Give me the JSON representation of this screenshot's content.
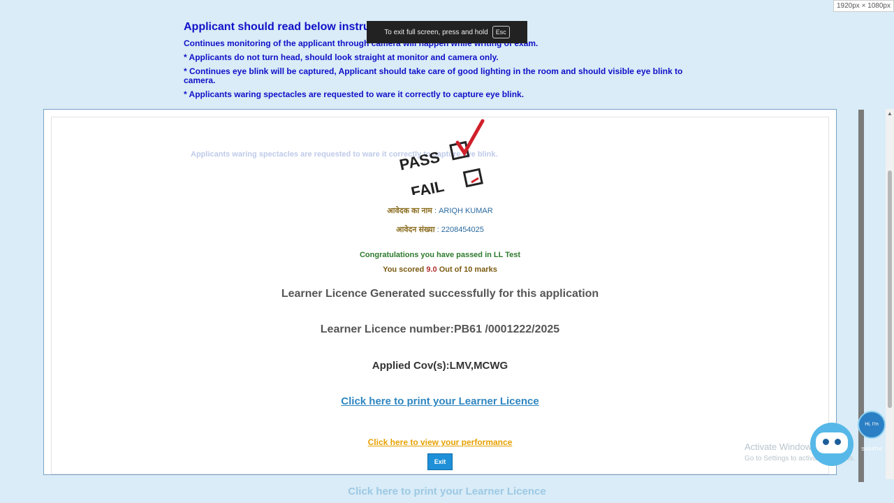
{
  "screen": {
    "resolution_badge": "1920px × 1080px"
  },
  "instructions": {
    "title": "Applicant should read below instru",
    "lines": [
      "Continues monitoring of the applicant through camera will happen while writing of exam.",
      "* Applicants do not turn head, should look straight at monitor and camera only.",
      "* Continues eye blink will be captured, Applicant should take care of good lighting in the room and should visible eye blink to camera.",
      "* Applicants waring spectacles are requested to ware it correctly to capture eye blink."
    ]
  },
  "fullscreen_toast": {
    "text": "To exit full screen, press and hold",
    "key": "Esc"
  },
  "ghost_text": "Applicants waring spectacles are requested to ware it correctly to capture eye blink.",
  "stamp": {
    "pass": "PASS",
    "fail": "FAIL"
  },
  "result": {
    "name_label": "आवेदक का नाम",
    "name_value": ": ARIQH KUMAR",
    "number_label": "आवेदन संख्या",
    "number_value": ": 2208454025",
    "congrats": "Congratulations you have passed in LL Test",
    "score_prefix": "You scored",
    "score_value": "9.0",
    "score_suffix": "Out of 10 marks",
    "ll_generated": "Learner Licence Generated successfully for this application",
    "ll_number": "Learner Licence number:PB61 /0001222/2025",
    "applied_cov": "Applied Cov(s):LMV,MCWG",
    "print_link": "Click here to print your Learner Licence",
    "performance_link": "Click here to view your performance",
    "exit_button": "Exit"
  },
  "windows_watermark": {
    "line1": "Activate Windows",
    "line2": "Go to Settings to activate Windows."
  },
  "chatbot": {
    "label": "Hi, I'm SARATHI"
  },
  "colors": {
    "background": "#d9ecf7",
    "instruction_text": "#1010c8",
    "link_blue": "#2e86c1",
    "performance_orange": "#e6a100",
    "congrats_green": "#2d7a2d"
  }
}
